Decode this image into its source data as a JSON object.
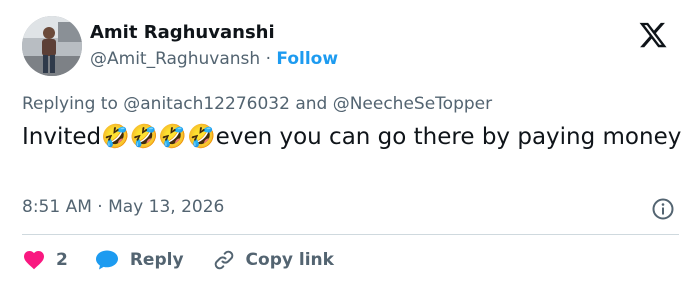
{
  "author": {
    "name": "Amit Raghuvanshi",
    "handle": "@Amit_Raghuvansh",
    "separator": "·",
    "follow_label": "Follow"
  },
  "tweet": {
    "replying_prefix": "Replying to",
    "mention_1": "@anitach12276032",
    "and_word": "and",
    "mention_2": "@NeecheSeTopper",
    "text": "Invited🤣🤣🤣🤣even you can go there by paying money",
    "timestamp": "8:51 AM · May 13, 2026"
  },
  "actions": {
    "like_count": "2",
    "reply_label": "Reply",
    "copy_link_label": "Copy link"
  },
  "icons": {
    "brand": "x-logo-icon",
    "info": "info-icon",
    "like": "heart-icon",
    "reply": "speech-bubble-icon",
    "copy": "link-icon"
  },
  "colors": {
    "accent": "#1d9bf0",
    "like": "#f91880",
    "text": "#0f1419",
    "muted": "#536471"
  }
}
